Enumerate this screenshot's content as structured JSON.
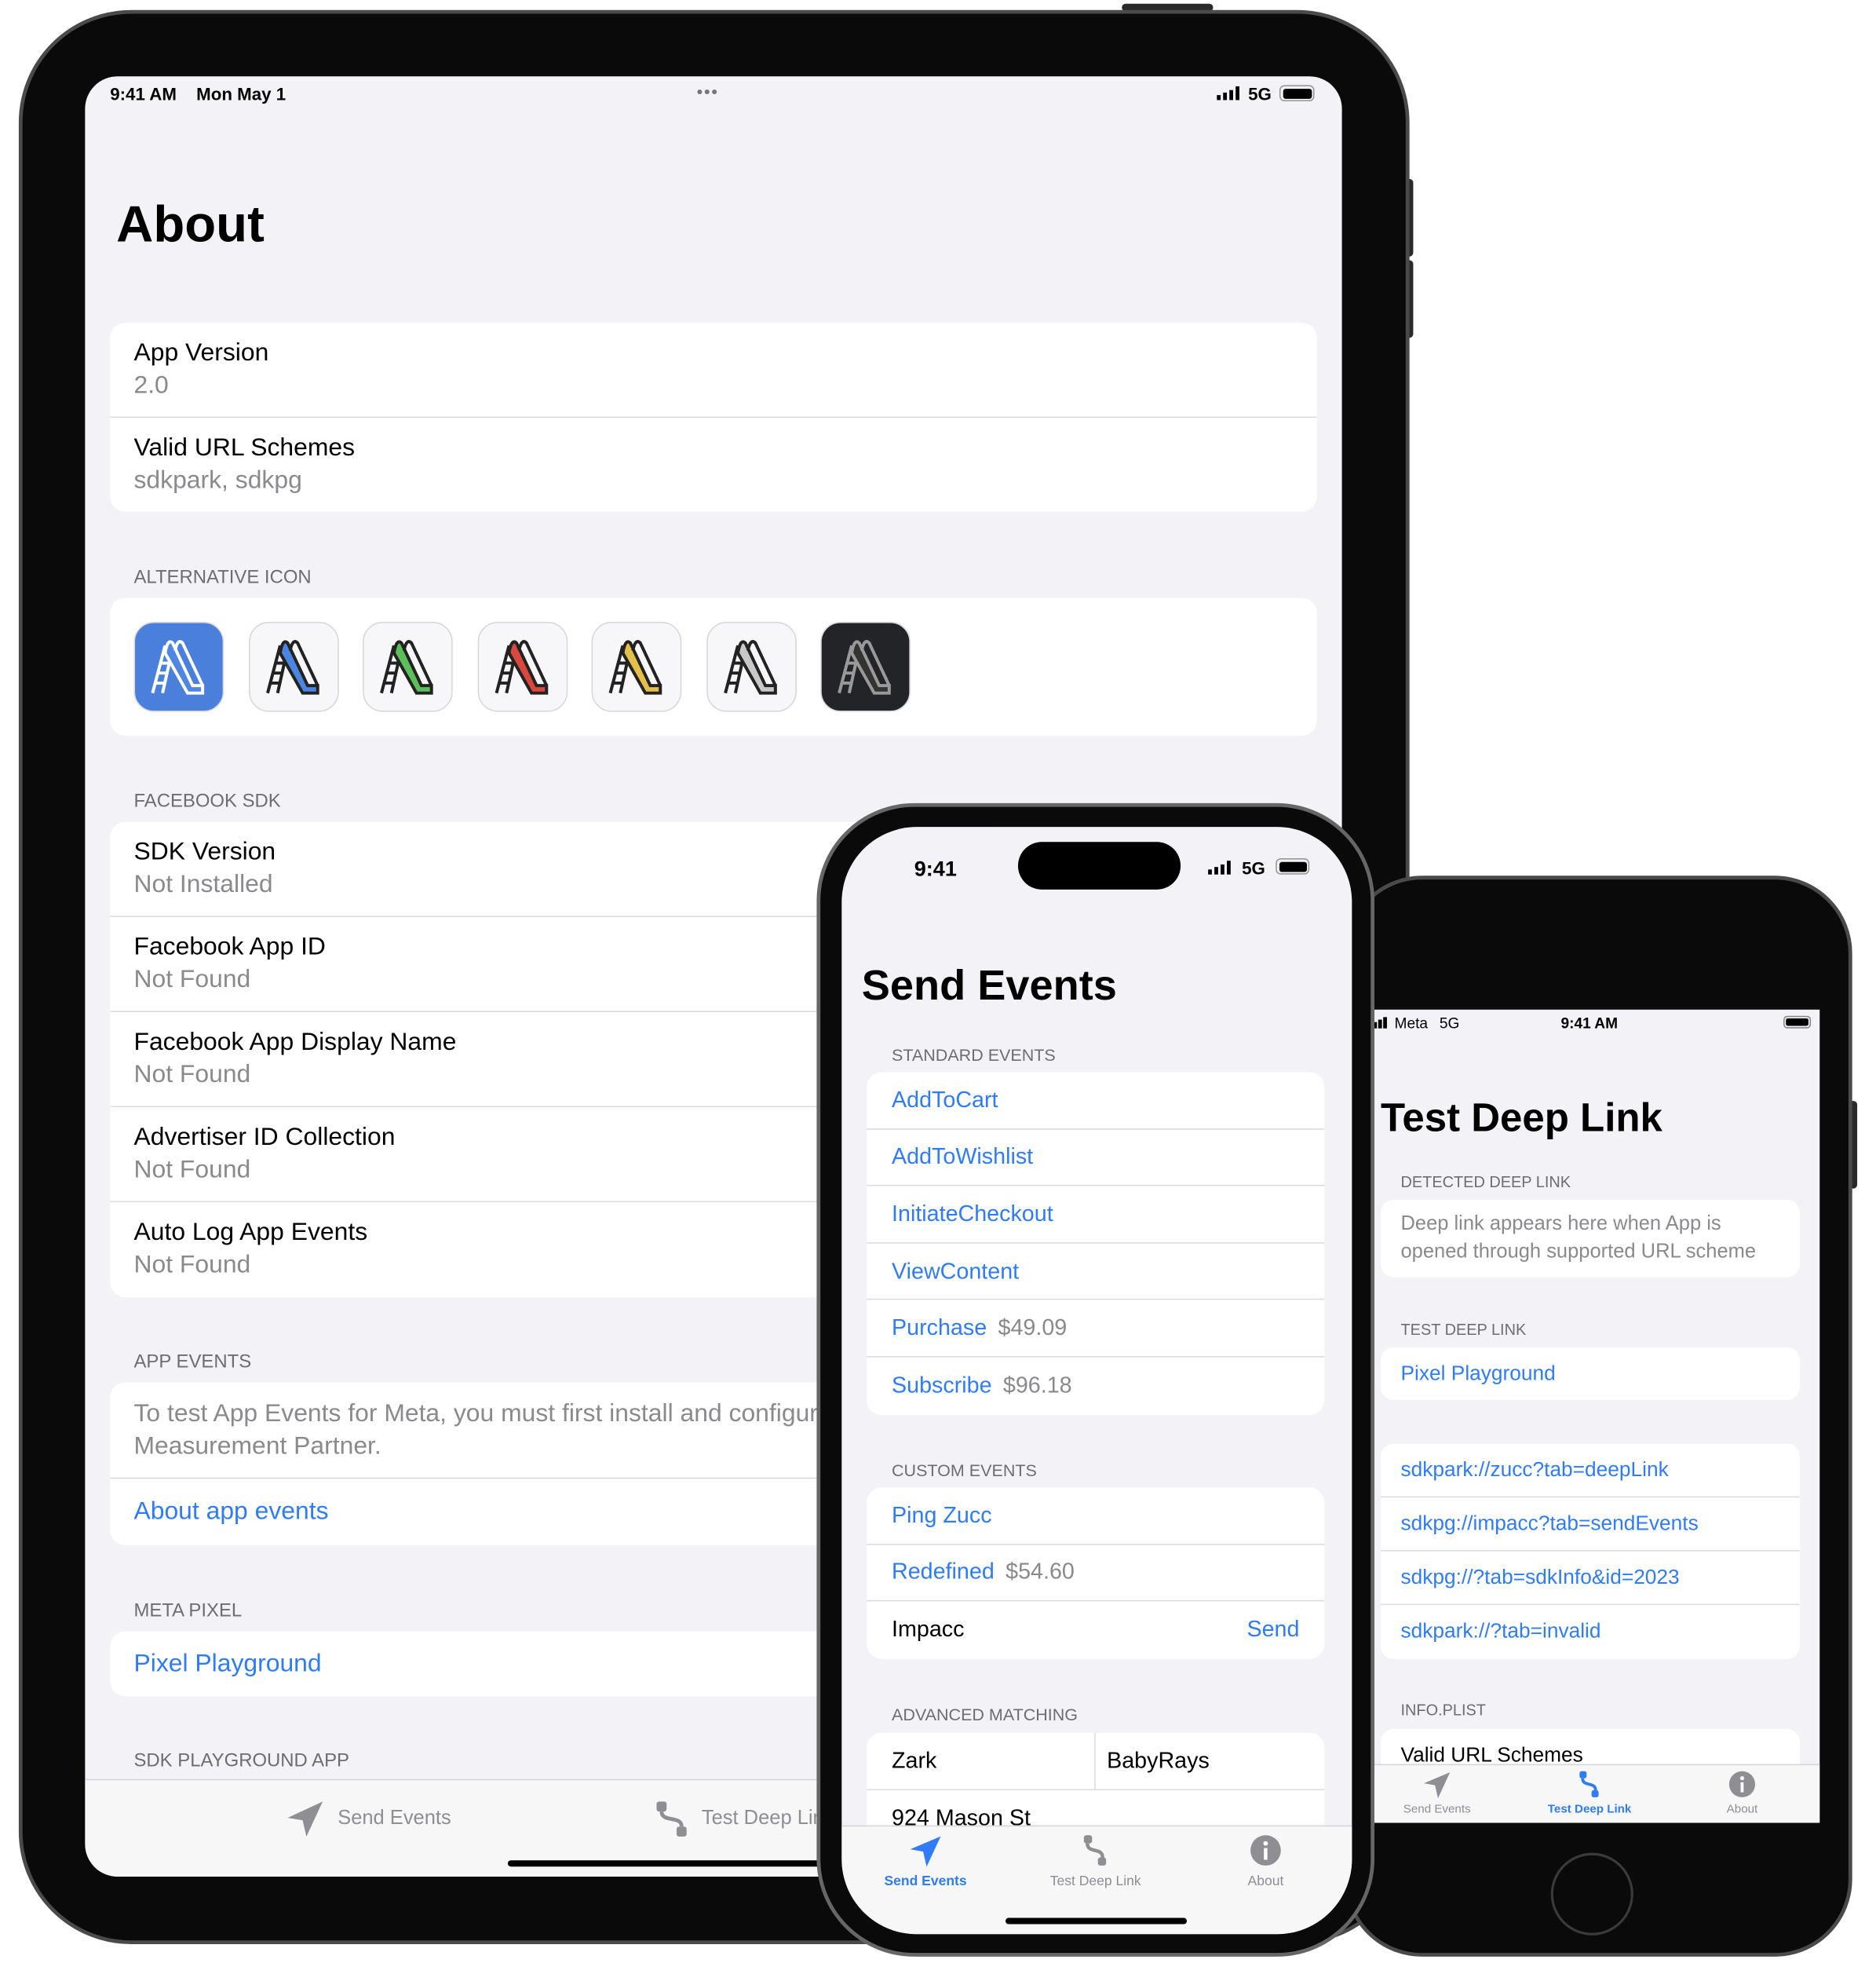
{
  "colors": {
    "accent": "#2f7cf6",
    "secondary_text": "#8a8a8e",
    "background": "#f2f2f7"
  },
  "ipad": {
    "status": {
      "time": "9:41 AM",
      "date": "Mon May 1",
      "network": "5G"
    },
    "title": "About",
    "info_rows": [
      {
        "label": "App Version",
        "value": "2.0"
      },
      {
        "label": "Valid URL Schemes",
        "value": "sdkpark, sdkpg"
      }
    ],
    "alt_icon_header": "Alternative Icon",
    "alt_icons": [
      {
        "name": "blue-blueprint",
        "fill": "#4f86e0",
        "stroke": "#ffffff",
        "bg": "#4a7fdc"
      },
      {
        "name": "blue",
        "fill": "#4c84e2",
        "stroke": "#222",
        "bg": "#f7f7f9"
      },
      {
        "name": "green",
        "fill": "#5cbf5a",
        "stroke": "#222",
        "bg": "#f7f7f9"
      },
      {
        "name": "red",
        "fill": "#d9483e",
        "stroke": "#222",
        "bg": "#f7f7f9"
      },
      {
        "name": "yellow",
        "fill": "#e2c04a",
        "stroke": "#222",
        "bg": "#f7f7f9"
      },
      {
        "name": "gray",
        "fill": "#c8c8c8",
        "stroke": "#222",
        "bg": "#f7f7f9"
      },
      {
        "name": "dark",
        "fill": "#333",
        "stroke": "#999",
        "bg": "#232428"
      }
    ],
    "fb_header": "Facebook SDK",
    "fb_rows": [
      {
        "label": "SDK Version",
        "value": "Not Installed"
      },
      {
        "label": "Facebook App ID",
        "value": "Not Found"
      },
      {
        "label": "Facebook App Display Name",
        "value": "Not Found"
      },
      {
        "label": "Advertiser ID Collection",
        "value": "Not Found"
      },
      {
        "label": "Auto Log App Events",
        "value": "Not Found"
      }
    ],
    "app_events_header": "App Events",
    "app_events_text": "To test App Events for Meta, you must first install and configure the Measurement Partner.",
    "app_events_link": "About app events",
    "meta_pixel_header": "Meta Pixel",
    "meta_pixel_link": "Pixel Playground",
    "sdk_app_header": "SDK Playground App",
    "tabs": [
      "Send Events",
      "Test Deep Link"
    ]
  },
  "iphone14": {
    "status": {
      "time": "9:41",
      "network": "5G"
    },
    "title": "Send Events",
    "standard_header": "Standard Events",
    "standard_events": [
      {
        "label": "AddToCart",
        "value": ""
      },
      {
        "label": "AddToWishlist",
        "value": ""
      },
      {
        "label": "InitiateCheckout",
        "value": ""
      },
      {
        "label": "ViewContent",
        "value": ""
      },
      {
        "label": "Purchase",
        "value": "$49.09"
      },
      {
        "label": "Subscribe",
        "value": "$96.18"
      }
    ],
    "custom_header": "Custom Events",
    "custom_events": [
      {
        "label": "Ping Zucc",
        "value": ""
      },
      {
        "label": "Redefined",
        "value": "$54.60"
      }
    ],
    "custom_input": {
      "value": "Impacc",
      "action": "Send"
    },
    "advanced_header": "Advanced Matching",
    "advanced": {
      "first_name": "Zark",
      "last_name": "BabyRays",
      "street": "924 Mason St"
    },
    "tabs": [
      {
        "label": "Send Events",
        "active": true
      },
      {
        "label": "Test Deep Link",
        "active": false
      },
      {
        "label": "About",
        "active": false
      }
    ]
  },
  "iphone_se": {
    "status": {
      "carrier": "Meta",
      "network": "5G",
      "time": "9:41 AM"
    },
    "title": "Test Deep Link",
    "detected_header": "Detected Deep Link",
    "detected_text": "Deep link appears here when App is opened through supported URL scheme",
    "test_header": "Test Deep Link",
    "test_link": "Pixel Playground",
    "links": [
      "sdkpark://zucc?tab=deepLink",
      "sdkpg://impacc?tab=sendEvents",
      "sdkpg://?tab=sdkInfo&id=2023",
      "sdkpark://?tab=invalid"
    ],
    "plist_header": "Info.plist",
    "plist_row": "Valid URL Schemes",
    "tabs": [
      {
        "label": "Send Events",
        "active": false
      },
      {
        "label": "Test Deep Link",
        "active": true
      },
      {
        "label": "About",
        "active": false
      }
    ]
  }
}
